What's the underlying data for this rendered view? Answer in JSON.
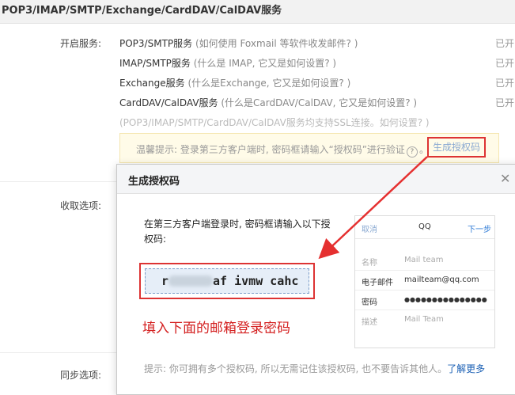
{
  "section_title": "POP3/IMAP/SMTP/Exchange/CardDAV/CalDAV服务",
  "labels": {
    "enable": "开启服务:",
    "receive": "收取选项:",
    "sync": "同步选项:"
  },
  "services": [
    {
      "name": "POP3/SMTP服务",
      "hint": " (如何使用 Foxmail 等软件收发邮件? )",
      "status": "已开"
    },
    {
      "name": "IMAP/SMTP服务",
      "hint": " (什么是 IMAP, 它又是如何设置? )",
      "status": "已开"
    },
    {
      "name": "Exchange服务",
      "hint": " (什么是Exchange, 它又是如何设置? )",
      "status": "已开"
    },
    {
      "name": "CardDAV/CalDAV服务",
      "hint": " (什么是CardDAV/CalDAV, 它又是如何设置? )",
      "status": "已开"
    }
  ],
  "ssl_note": "(POP3/IMAP/SMTP/CardDAV/CalDAV服务均支持SSL连接。如何设置? )",
  "tip": {
    "text_before": "温馨提示: 登录第三方客户端时, 密码框请输入“授权码”进行验证",
    "help_glyph": "?",
    "text_after": "。",
    "button": "生成授权码"
  },
  "dialog": {
    "title": "生成授权码",
    "close": "✕",
    "instruction": "在第三方客户端登录时, 密码框请输入以下授权码:",
    "code_prefix": "r",
    "code_suffix": "af ivmw cahc",
    "red_note": "填入下面的邮箱登录密码",
    "bottom_hint": "提示: 你可拥有多个授权码, 所以无需记住该授权码, 也不要告诉其他人。",
    "learn_more": "了解更多",
    "client": {
      "cancel": "取消",
      "app": "QQ",
      "next": "下一步",
      "rows": [
        {
          "key": "名称",
          "value": "Mail team",
          "dim": true
        },
        {
          "key": "电子邮件",
          "value": "mailteam@qq.com",
          "dim": false
        },
        {
          "key": "密码",
          "value": "●●●●●●●●●●●●●●●",
          "dim": false
        },
        {
          "key": "描述",
          "value": "Mail Team",
          "dim": true
        }
      ]
    }
  },
  "colors": {
    "highlight": "#d33333",
    "link": "#1a5fb4",
    "tip_bg": "#fffbe8"
  }
}
